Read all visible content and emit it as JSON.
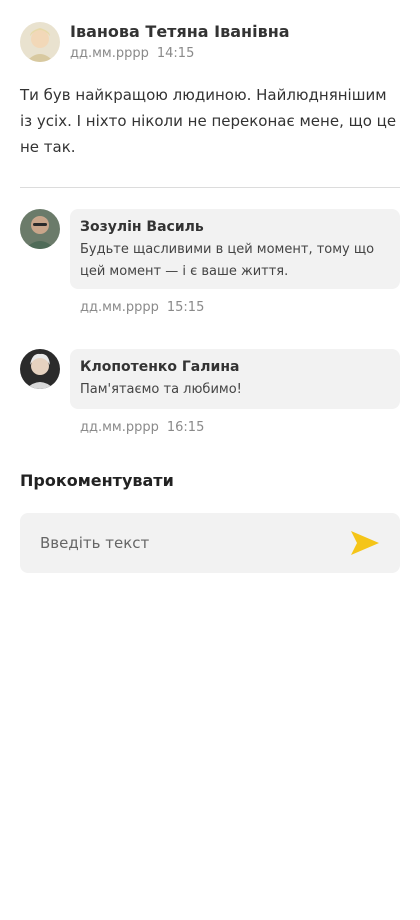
{
  "post": {
    "author": "Іванова Тетяна Іванівна",
    "date": "дд.мм.рррр",
    "time": "14:15",
    "text": "Ти був найкращою людиною. Найлюднянішим із усіх. І ніхто ніколи не переконає мене, що це не так.",
    "avatar_icon": "user-avatar-photo"
  },
  "comments": [
    {
      "author": "Зозулін Василь",
      "text": "Будьте щасливими в цей момент, тому що цей момент — і є ваше життя.",
      "date": "дд.мм.рррр",
      "time": "15:15",
      "avatar_icon": "user-avatar-photo"
    },
    {
      "author": "Клопотенко Галина",
      "text": "Пам'ятаємо та любимо!",
      "date": "дд.мм.рррр",
      "time": "16:15",
      "avatar_icon": "user-avatar-photo"
    }
  ],
  "compose": {
    "title": "Прокоментувати",
    "placeholder": "Введіть текст",
    "value": "",
    "send_icon": "send-icon"
  },
  "colors": {
    "accent": "#f5c518",
    "bubble": "#f2f2f2",
    "meta": "#8a8a8a"
  }
}
